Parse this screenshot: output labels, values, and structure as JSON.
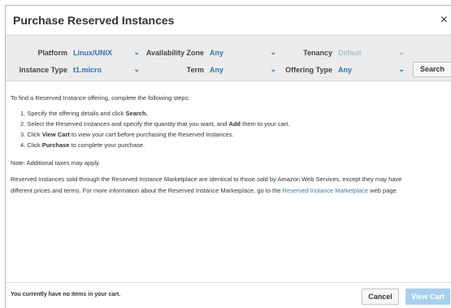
{
  "dialog": {
    "title": "Purchase Reserved Instances",
    "close": "×"
  },
  "filters": {
    "platform_label": "Platform",
    "platform_value": "Linux/UNIX",
    "az_label": "Availability Zone",
    "az_value": "Any",
    "tenancy_label": "Tenancy",
    "tenancy_value": "Default",
    "instance_label": "Instance Type",
    "instance_value": "t1.micro",
    "term_label": "Term",
    "term_value": "Any",
    "offering_label": "Offering Type",
    "offering_value": "Any",
    "search_label": "Search",
    "chevron": "⌄"
  },
  "body": {
    "intro": "To find a Reserved Instance offering, complete the following steps:",
    "steps": [
      {
        "num": "1.",
        "pre": "Specify the offering details and click ",
        "bold": "Search.",
        "post": ""
      },
      {
        "num": "2.",
        "pre": "Select the Reserved Instances and specify the quantity that you want, and ",
        "bold": "Add",
        "post": " them to your cart."
      },
      {
        "num": "3.",
        "pre": "Click ",
        "bold": "View Cart",
        "post": " to view your cart before purchasing the Reserved Instances."
      },
      {
        "num": "4.",
        "pre": "Click ",
        "bold": "Purchase",
        "post": " to complete your purchase."
      }
    ],
    "note": "Note: Additional taxes may apply.",
    "market_line1": "Reserved Instances sold through the Reserved Instance Marketplace are identical to those sold by Amazon Web Services, except they may have",
    "market_line2_pre": "different prices and terms. For more information about the Reserved Instance Marketplace, go to the ",
    "market_link": "Reserved Instance Marketplace",
    "market_line2_post": " web page."
  },
  "footer": {
    "empty_cart": "You currently have no items in your cart.",
    "cancel_label": "Cancel",
    "view_cart_label": "View Cart"
  },
  "colors": {
    "link": "#2f74b5",
    "disabled_button": "#a7cff0"
  }
}
